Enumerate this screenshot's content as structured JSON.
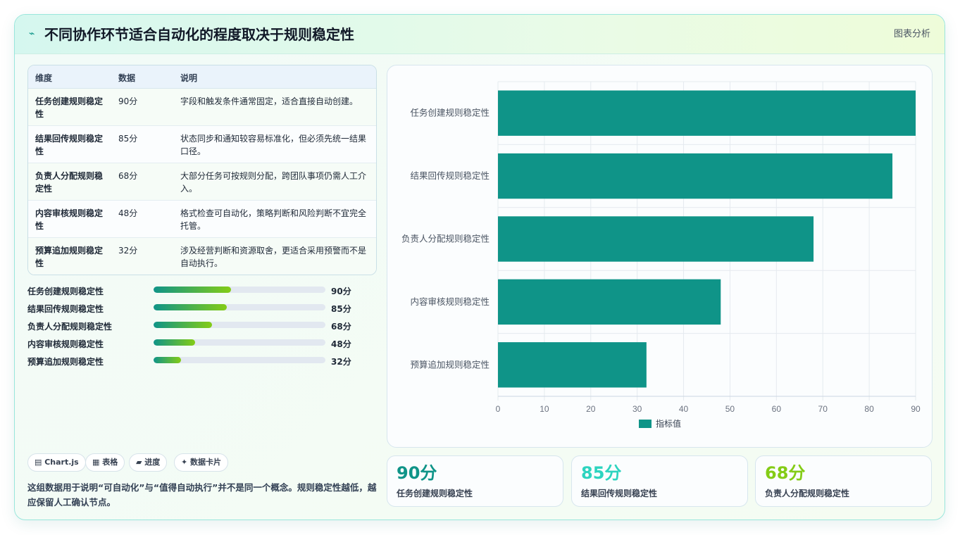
{
  "header": {
    "icon": "lightning-icon",
    "title": "不同协作环节适合自动化的程度取决于规则稳定性",
    "right_label": "图表分析"
  },
  "table": {
    "headers": [
      "维度",
      "数据",
      "说明"
    ],
    "rows": [
      {
        "dim": "任务创建规则稳定性",
        "value": "90分",
        "desc": "字段和触发条件通常固定，适合直接自动创建。"
      },
      {
        "dim": "结果回传规则稳定性",
        "value": "85分",
        "desc": "状态同步和通知较容易标准化，但必须先统一结果口径。"
      },
      {
        "dim": "负责人分配规则稳定性",
        "value": "68分",
        "desc": "大部分任务可按规则分配，跨团队事项仍需人工介入。"
      },
      {
        "dim": "内容审核规则稳定性",
        "value": "48分",
        "desc": "格式检查可自动化，策略判断和风险判断不宜完全托管。"
      },
      {
        "dim": "预算追加规则稳定性",
        "value": "32分",
        "desc": "涉及经营判断和资源取舍，更适合采用预警而不是自动执行。"
      }
    ]
  },
  "progress": [
    {
      "label": "任务创建规则稳定性",
      "value": 90,
      "display": "90分"
    },
    {
      "label": "结果回传规则稳定性",
      "value": 85,
      "display": "85分"
    },
    {
      "label": "负责人分配规则稳定性",
      "value": 68,
      "display": "68分"
    },
    {
      "label": "内容审核规则稳定性",
      "value": 48,
      "display": "48分"
    },
    {
      "label": "预算追加规则稳定性",
      "value": 32,
      "display": "32分"
    }
  ],
  "tags": [
    {
      "icon": "chart-icon",
      "label": "▤ Chart.js"
    },
    {
      "icon": "table-icon",
      "label": "▦ 表格"
    },
    {
      "icon": "progress-icon",
      "label": "▰ 进度"
    },
    {
      "icon": "sparkle-icon",
      "label": "✦ 数据卡片"
    }
  ],
  "note": "这组数据用于说明“可自动化”与“值得自动执行”并不是同一个概念。规则稳定性越低，越应保留人工确认节点。",
  "kpis": [
    {
      "value": "90分",
      "label": "任务创建规则稳定性",
      "color": "#0f9488"
    },
    {
      "value": "85分",
      "label": "结果回传规则稳定性",
      "color": "#2dd4bf"
    },
    {
      "value": "68分",
      "label": "负责人分配规则稳定性",
      "color": "#84cc16"
    }
  ],
  "chart_data": {
    "type": "bar",
    "orientation": "horizontal",
    "categories": [
      "任务创建规则稳定性",
      "结果回传规则稳定性",
      "负责人分配规则稳定性",
      "内容审核规则稳定性",
      "预算追加规则稳定性"
    ],
    "series": [
      {
        "name": "指标值",
        "values": [
          90,
          85,
          68,
          48,
          32
        ]
      }
    ],
    "xticks": [
      "0",
      "10",
      "20",
      "30",
      "40",
      "50",
      "60",
      "70",
      "80",
      "90"
    ],
    "xlim": [
      0,
      90
    ],
    "bar_color": "#0f9488",
    "grid": true,
    "legend": "bottom"
  }
}
